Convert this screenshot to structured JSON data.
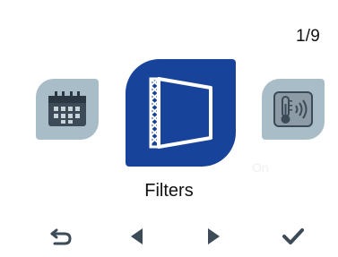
{
  "header": {
    "page_indicator": "1/9"
  },
  "carousel": {
    "left_item": {
      "icon": "calendar-icon"
    },
    "center_item": {
      "icon": "filter-icon",
      "label": "Filters"
    },
    "right_item": {
      "icon": "thermometer-sound-icon",
      "status": "On"
    }
  },
  "nav": {
    "back": {
      "icon": "back-arrow-icon"
    },
    "previous": {
      "icon": "triangle-left-icon"
    },
    "next": {
      "icon": "triangle-right-icon"
    },
    "confirm": {
      "icon": "checkmark-icon"
    }
  },
  "colors": {
    "selected_tile": "#17449a",
    "unselected_tile": "#a8bdc8",
    "icon_dark": "#3d4a58",
    "text": "#111111"
  }
}
